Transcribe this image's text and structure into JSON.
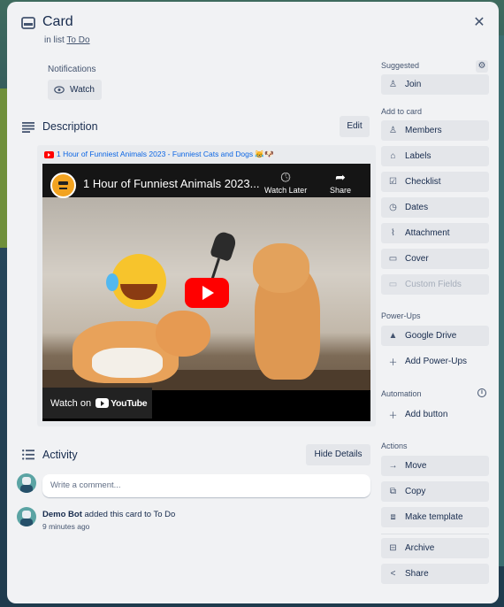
{
  "header": {
    "title": "Card",
    "list_prefix": "in list",
    "list_name": "To Do",
    "icon": "card-icon",
    "close_icon": "close-icon"
  },
  "notifications": {
    "label": "Notifications",
    "watch_label": "Watch",
    "watch_icon": "eye-icon"
  },
  "description": {
    "title": "Description",
    "edit_label": "Edit",
    "link_text": "1 Hour of Funniest Animals 2023 - Funniest Cats and Dogs 😹🐶",
    "video": {
      "title": "1 Hour of Funniest Animals 2023...",
      "watch_later": "Watch Later",
      "share": "Share",
      "watch_on": "Watch on",
      "youtube": "YouTube"
    }
  },
  "activity": {
    "title": "Activity",
    "hide_details": "Hide Details",
    "comment_placeholder": "Write a comment...",
    "entries": [
      {
        "user": "Demo Bot",
        "text": "added this card to To Do",
        "time": "9 minutes ago"
      }
    ]
  },
  "sidebar": {
    "suggested": {
      "heading": "Suggested",
      "items": [
        {
          "label": "Join",
          "icon": "person-icon"
        }
      ]
    },
    "add_to_card": {
      "heading": "Add to card",
      "items": [
        {
          "label": "Members",
          "icon": "person-icon"
        },
        {
          "label": "Labels",
          "icon": "tag-icon"
        },
        {
          "label": "Checklist",
          "icon": "checkbox-icon"
        },
        {
          "label": "Dates",
          "icon": "clock-icon"
        },
        {
          "label": "Attachment",
          "icon": "paperclip-icon"
        },
        {
          "label": "Cover",
          "icon": "cover-icon"
        },
        {
          "label": "Custom Fields",
          "icon": "custom-fields-icon"
        }
      ]
    },
    "power_ups": {
      "heading": "Power-Ups",
      "items": [
        {
          "label": "Google Drive",
          "icon": "google-drive-icon"
        },
        {
          "label": "Add Power-Ups",
          "icon": "plus-icon"
        }
      ]
    },
    "automation": {
      "heading": "Automation",
      "items": [
        {
          "label": "Add button",
          "icon": "plus-icon"
        }
      ]
    },
    "actions": {
      "heading": "Actions",
      "items": [
        {
          "label": "Move",
          "icon": "arrow-right-icon"
        },
        {
          "label": "Copy",
          "icon": "copy-icon"
        },
        {
          "label": "Make template",
          "icon": "template-icon"
        },
        {
          "label": "Archive",
          "icon": "archive-icon"
        },
        {
          "label": "Share",
          "icon": "share-icon"
        }
      ]
    }
  },
  "colors": {
    "modal_bg": "#f1f2f4",
    "button_bg": "#e4e6ea",
    "text": "#172b4d",
    "link": "#0c66e4",
    "youtube_red": "#ff0000"
  }
}
